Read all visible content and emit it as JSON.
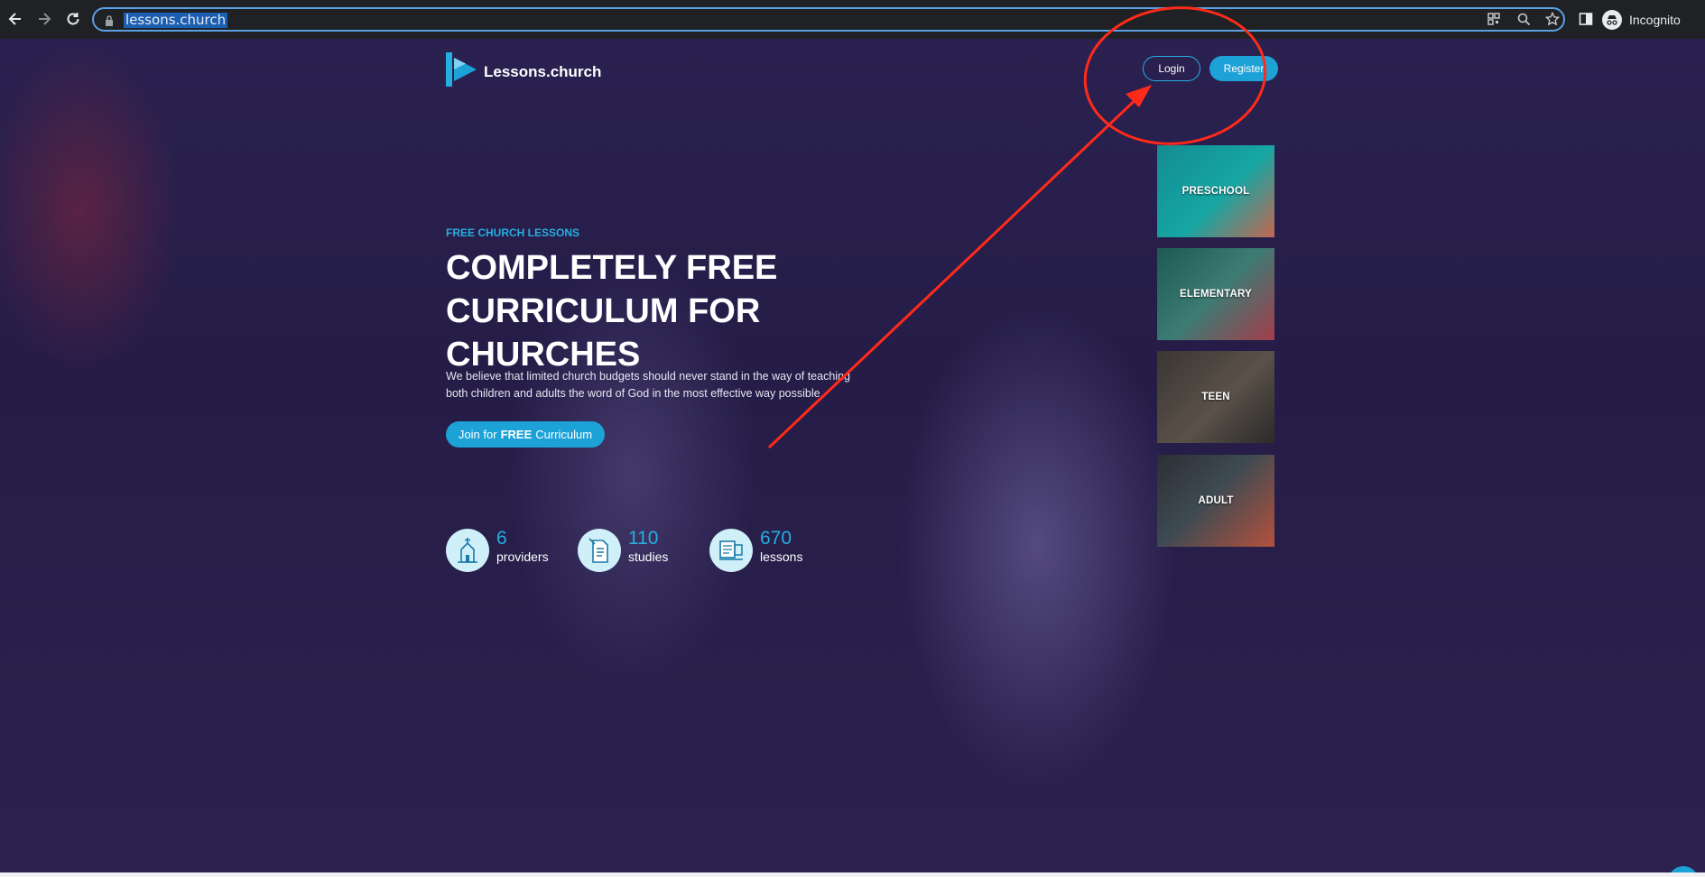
{
  "browser": {
    "url": "lessons.church",
    "profile_label": "Incognito",
    "accent_color": "#5aa0e6",
    "icons": [
      "back-icon",
      "forward-icon",
      "reload-icon",
      "lock-icon",
      "qr-code-icon",
      "zoom-icon",
      "star-icon",
      "side-panel-icon",
      "incognito-icon"
    ]
  },
  "header": {
    "logo_text": "Lessons.church",
    "login_label": "Login",
    "register_label": "Register"
  },
  "hero": {
    "kicker": "FREE CHURCH LESSONS",
    "headline": "COMPLETELY FREE CURRICULUM FOR CHURCHES",
    "description": "We believe that limited church budgets should never stand in the way of teaching both children and adults the word of God in the most effective way possible.",
    "cta_prefix": "Join for",
    "cta_bold": "FREE",
    "cta_suffix": "Curriculum"
  },
  "stats": [
    {
      "value": "6",
      "label": "providers",
      "icon": "church-icon"
    },
    {
      "value": "110",
      "label": "studies",
      "icon": "document-icon"
    },
    {
      "value": "670",
      "label": "lessons",
      "icon": "book-icon"
    }
  ],
  "categories": [
    {
      "label": "PRESCHOOL"
    },
    {
      "label": "ELEMENTARY"
    },
    {
      "label": "TEEN"
    },
    {
      "label": "ADULT"
    }
  ],
  "colors": {
    "brand_blue": "#1da2d8",
    "accent_cyan": "#27aee0",
    "annotation_red": "#ff2a1a",
    "page_bg": "#2a2150"
  }
}
